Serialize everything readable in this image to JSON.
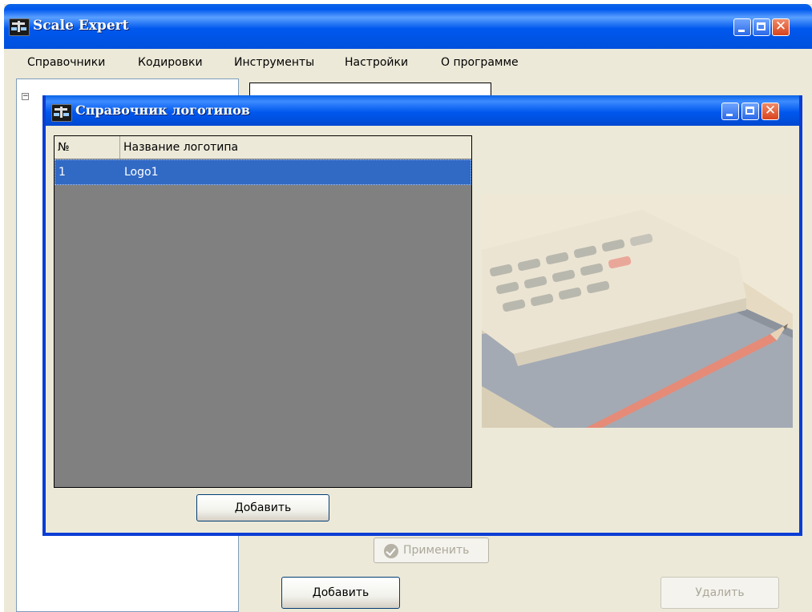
{
  "main_window": {
    "title": "Scale Expert",
    "menu": [
      "Справочники",
      "Кодировки",
      "Инструменты",
      "Настройки",
      "О программе"
    ],
    "tree_toggle": "−",
    "apply_button": "Применить",
    "add_button": "Добавить",
    "delete_button": "Удалить"
  },
  "dialog": {
    "title": "Справочник логотипов",
    "columns": [
      "№",
      "Название логотипа"
    ],
    "rows": [
      {
        "num": "1",
        "name": "Logo1",
        "selected": true
      }
    ],
    "add_button": "Добавить",
    "preview_image": "logo-preview-image"
  },
  "colors": {
    "titlebar": "#0058ee",
    "selection": "#316ac5",
    "window_face": "#ece9d8",
    "grid_background": "#808080",
    "close_button": "#d8431d"
  }
}
